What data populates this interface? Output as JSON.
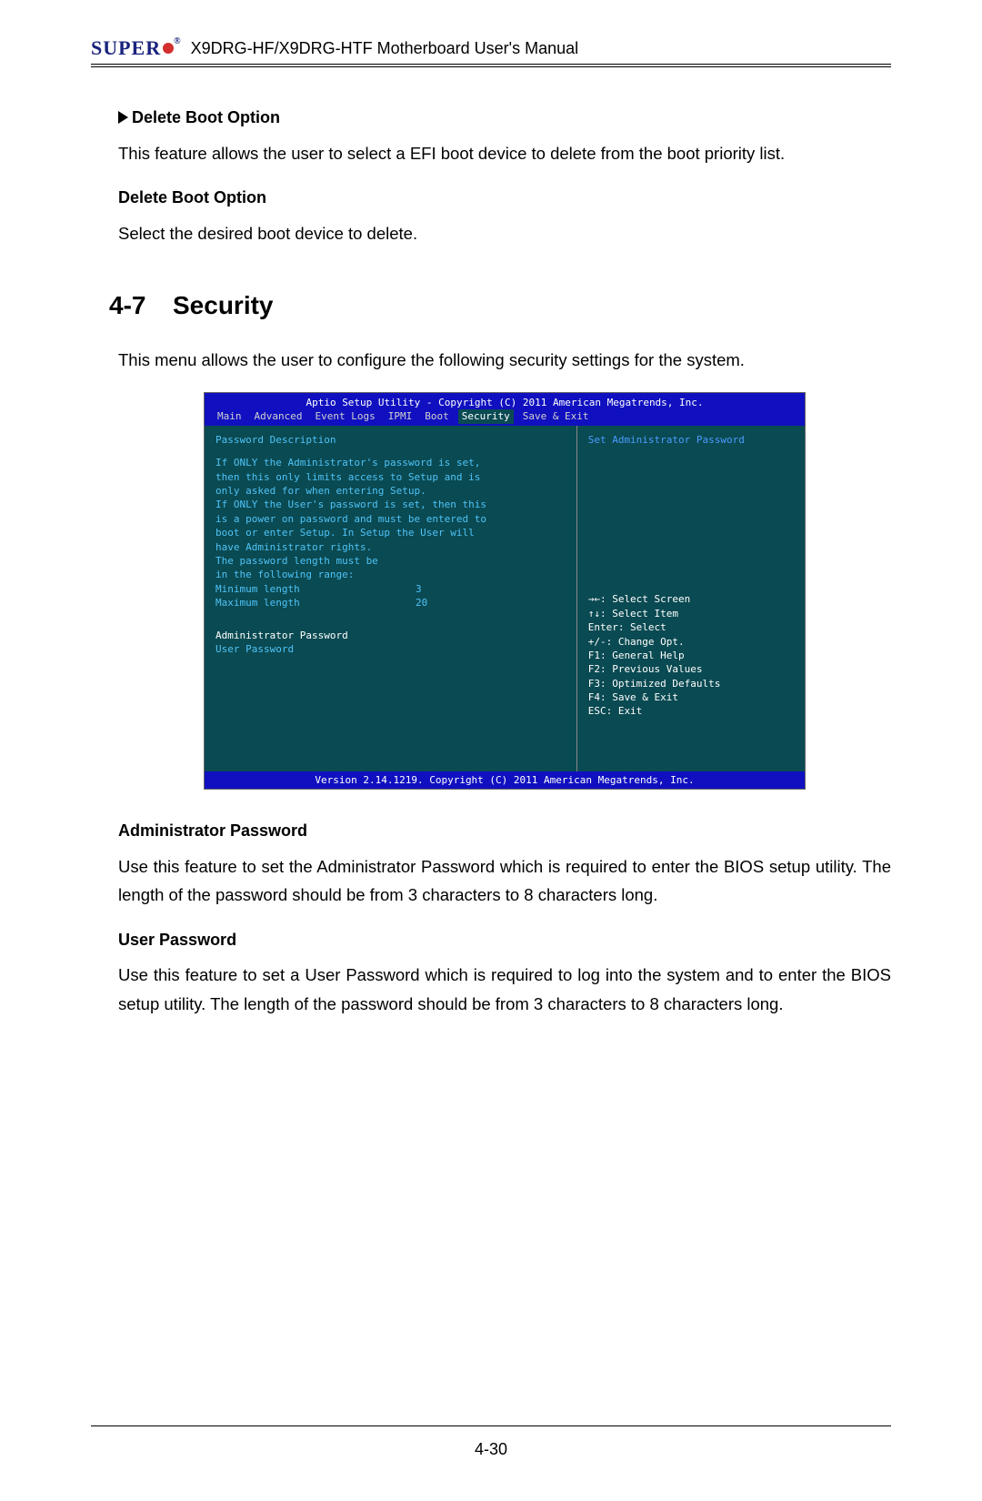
{
  "header": {
    "brand_prefix": "SUPER",
    "brand_suffix": "",
    "trademark": "®",
    "title": "X9DRG-HF/X9DRG-HTF Motherboard User's Manual"
  },
  "sections": {
    "s1_heading": "Delete Boot Option",
    "s1_body": "This feature allows the user to select a EFI boot device to delete from the boot priority list.",
    "s2_heading": "Delete Boot Option",
    "s2_body": "Select the desired boot device to delete.",
    "sec_num": "4-7",
    "sec_title": "Security",
    "sec_intro": "This menu allows the user to configure the following security settings for the system.",
    "admin_h": "Administrator Password",
    "admin_body": "Use this feature to set the Administrator Password which is required to enter the BIOS setup utility. The length of the password should be from 3 characters to 8 characters long.",
    "user_h": "User Password",
    "user_body": "Use this feature to set a User Password which is required to log into the system and to enter the BIOS setup utility. The length of the password should be from 3 characters to 8 characters long."
  },
  "bios": {
    "top": "Aptio Setup Utility - Copyright (C) 2011 American Megatrends, Inc.",
    "tabs": [
      "Main",
      "Advanced",
      "Event Logs",
      "IPMI",
      "Boot",
      "Security",
      "Save & Exit"
    ],
    "left": {
      "title": "Password Description",
      "lines": [
        "If ONLY the Administrator's password is set,",
        "then this only limits access to Setup and is",
        "only asked for when entering Setup.",
        "If ONLY the User's password is set, then this",
        "is a power on password and must be entered to",
        "boot or enter Setup. In Setup the User will",
        "have Administrator rights.",
        "The password length must be",
        "in the following range:"
      ],
      "min_k": "Minimum length",
      "min_v": "3",
      "max_k": "Maximum length",
      "max_v": "20",
      "link1": "Administrator Password",
      "link2": "User Password"
    },
    "right": {
      "hint": "Set Administrator Password",
      "help": [
        "→←: Select Screen",
        "↑↓: Select Item",
        "Enter: Select",
        "+/-: Change Opt.",
        "F1: General Help",
        "F2: Previous Values",
        "F3: Optimized Defaults",
        "F4: Save & Exit",
        "ESC: Exit"
      ]
    },
    "footer": "Version 2.14.1219. Copyright (C) 2011 American Megatrends, Inc."
  },
  "page_number": "4-30"
}
